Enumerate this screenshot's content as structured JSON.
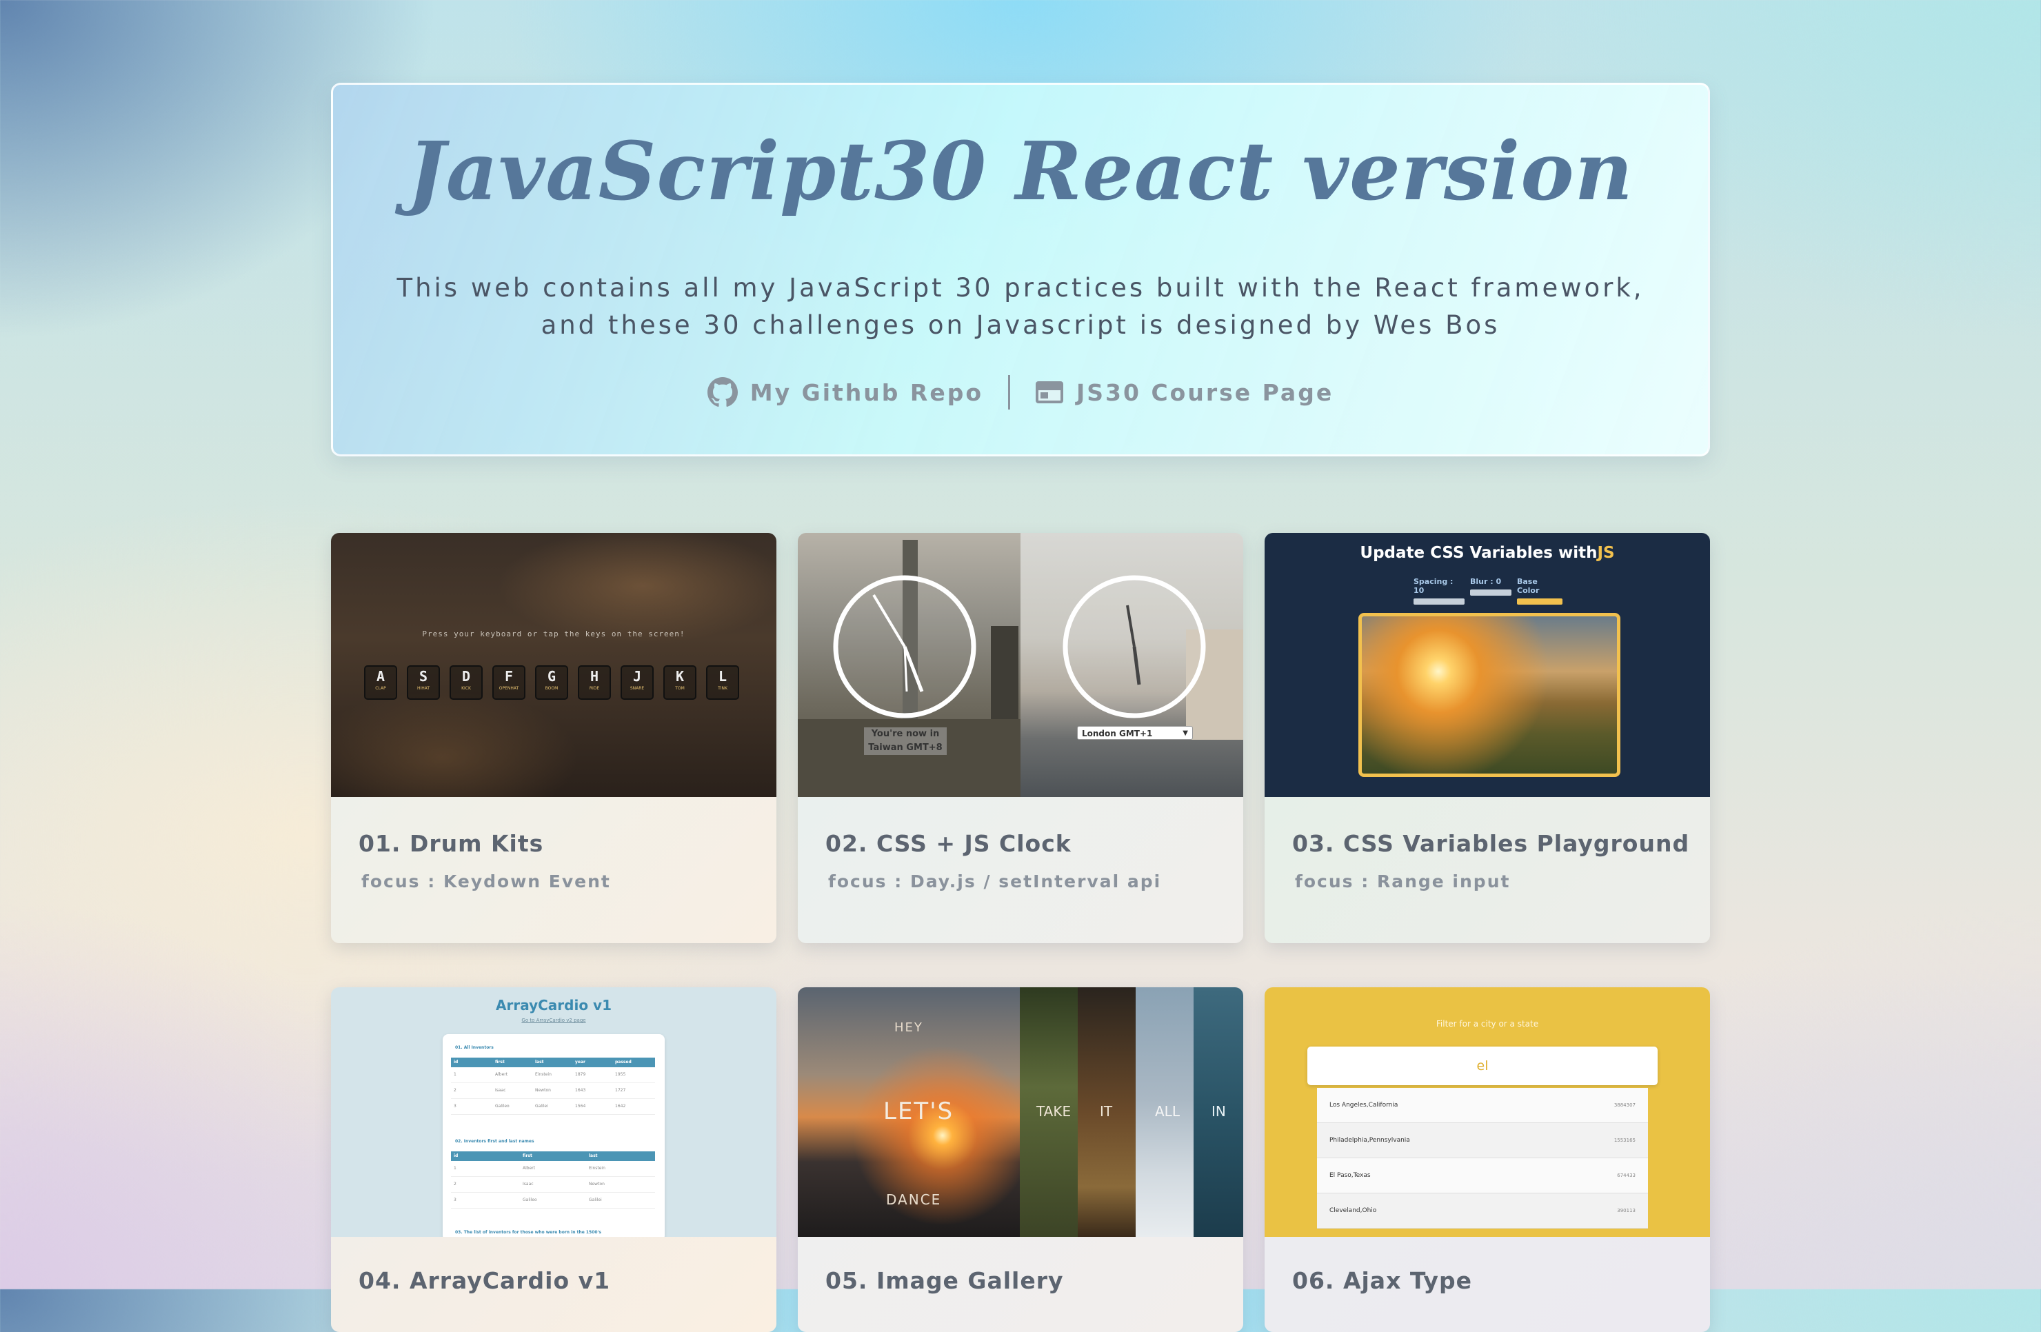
{
  "hero": {
    "title": "JavaScript30 React version",
    "description": "This web contains all my JavaScript 30 practices built with the React framework, and these 30 challenges on Javascript is designed by Wes Bos",
    "links": [
      {
        "label": "My Github Repo",
        "icon": "github-icon"
      },
      {
        "label": "JS30 Course Page",
        "icon": "browser-window-icon"
      }
    ]
  },
  "cards": [
    {
      "title": "01. Drum Kits",
      "focus": "focus : Keydown Event",
      "thumb": {
        "prompt": "Press your keyboard or tap the keys on the screen!",
        "keys": [
          {
            "key": "A",
            "sound": "CLAP"
          },
          {
            "key": "S",
            "sound": "HIHAT"
          },
          {
            "key": "D",
            "sound": "KICK"
          },
          {
            "key": "F",
            "sound": "OPENHAT"
          },
          {
            "key": "G",
            "sound": "BOOM"
          },
          {
            "key": "H",
            "sound": "RIDE"
          },
          {
            "key": "J",
            "sound": "SNARE"
          },
          {
            "key": "K",
            "sound": "TOM"
          },
          {
            "key": "L",
            "sound": "TINK"
          }
        ]
      }
    },
    {
      "title": "02. CSS + JS Clock",
      "focus": "focus : Day.js / setInterval api",
      "thumb": {
        "left_caption_1": "You're now in",
        "left_caption_2": "Taiwan GMT+8",
        "right_select": "London GMT+1"
      }
    },
    {
      "title": "03. CSS Variables Playground",
      "focus": "focus : Range input",
      "thumb": {
        "heading": "Update CSS Variables with",
        "heading_accent": "JS",
        "control_spacing": "Spacing : 10",
        "control_blur": "Blur : 0",
        "control_color": "Base Color",
        "accent_color": "#f2c14e"
      }
    },
    {
      "title": "04. ArrayCardio v1",
      "focus": "",
      "thumb": {
        "heading": "ArrayCardio v1",
        "subheading": "Go to ArrayCardio v2 page",
        "section1": "01. All Inventors",
        "section1_headers": [
          "id",
          "first",
          "last",
          "year",
          "passed"
        ],
        "section1_rows": [
          [
            "1",
            "Albert",
            "Einstein",
            "1879",
            "1955"
          ],
          [
            "2",
            "Isaac",
            "Newton",
            "1643",
            "1727"
          ],
          [
            "3",
            "Galileo",
            "Galilei",
            "1564",
            "1642"
          ]
        ],
        "section2": "02. Inventors first and last names",
        "section2_headers": [
          "id",
          "first",
          "last"
        ],
        "section2_rows": [
          [
            "1",
            "Albert",
            "Einstein"
          ],
          [
            "2",
            "Isaac",
            "Newton"
          ],
          [
            "3",
            "Galileo",
            "Galilei"
          ]
        ],
        "section3": "03. The list of inventors for those who were born in the 1500's"
      }
    },
    {
      "title": "05. Image Gallery",
      "focus": "",
      "thumb": {
        "words": [
          "HEY",
          "LET'S",
          "DANCE",
          "TAKE",
          "IT",
          "ALL",
          "IN"
        ]
      }
    },
    {
      "title": "06. Ajax Type",
      "focus": "",
      "thumb": {
        "heading": "Filter for a city or a state",
        "search_value": "el",
        "results": [
          {
            "place": "Los Angeles,California",
            "pop": "3884307"
          },
          {
            "place": "Philadelphia,Pennsylvania",
            "pop": "1553165"
          },
          {
            "place": "El Paso,Texas",
            "pop": "674433"
          },
          {
            "place": "Cleveland,Ohio",
            "pop": "390113"
          }
        ]
      }
    }
  ]
}
